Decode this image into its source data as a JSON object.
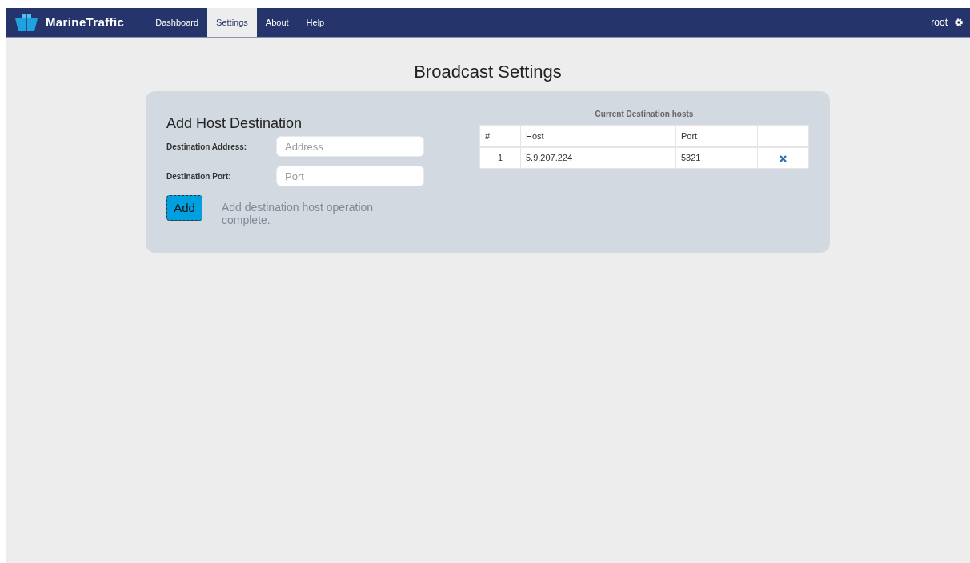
{
  "navbar": {
    "brand": "MarineTraffic",
    "tabs": [
      {
        "label": "Dashboard",
        "selected": false
      },
      {
        "label": "Settings",
        "selected": true
      },
      {
        "label": "About",
        "selected": false
      },
      {
        "label": "Help",
        "selected": false
      }
    ],
    "user": "root"
  },
  "page_title": "Broadcast Settings",
  "add_form": {
    "heading": "Add Host Destination",
    "fields": [
      {
        "label": "Destination Address:",
        "placeholder": "Address"
      },
      {
        "label": "Destination Port:",
        "placeholder": "Port"
      }
    ],
    "button": "Add",
    "message": "Add destination host operation complete."
  },
  "hosts_table": {
    "caption": "Current Destination hosts",
    "columns": [
      "#",
      "Host",
      "Port"
    ],
    "rows": [
      {
        "number": "1",
        "host": "5.9.207.224",
        "port": "5321"
      }
    ]
  }
}
